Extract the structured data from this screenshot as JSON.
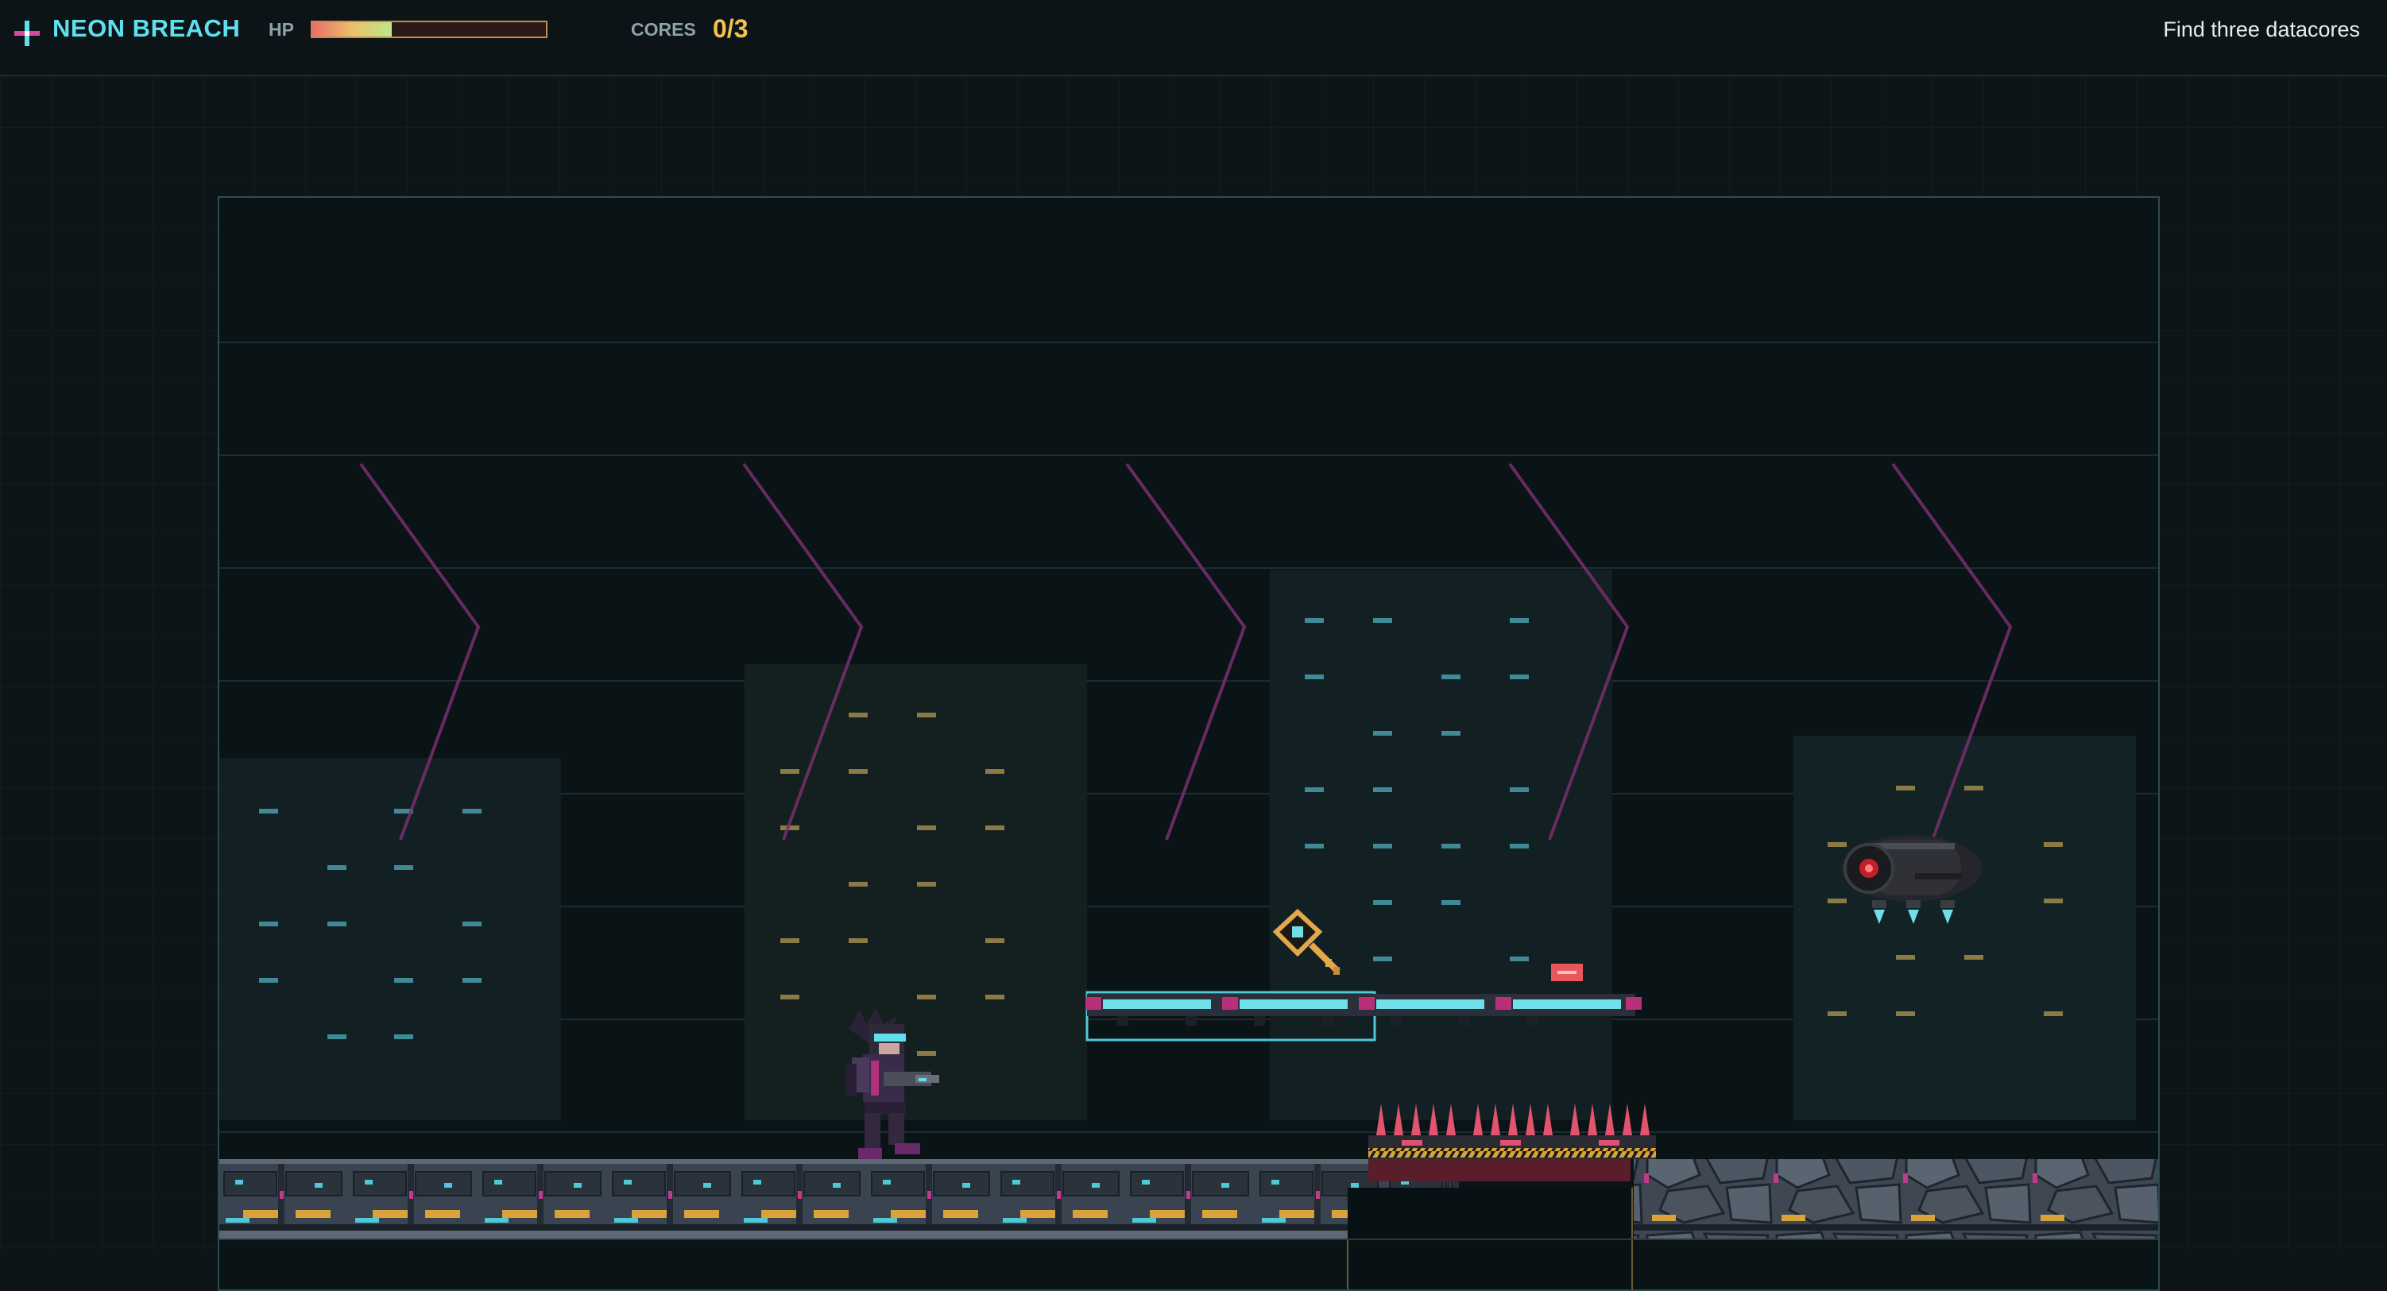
{
  "app": {
    "title": "NEON BREACH",
    "logo_icon": "crosshair-plus-icon"
  },
  "hud": {
    "hp_label": "HP",
    "hp_fraction": 0.34,
    "cores_label": "CORES",
    "cores_value": "0/3",
    "cores_collected": 0,
    "cores_total": 3,
    "objective": "Find three datacores"
  },
  "colors": {
    "accent_cyan": "#5ee0ee",
    "accent_gold": "#f2c24c",
    "neon_magenta": "#b0307a",
    "hp_gradient": [
      "#e86d6b",
      "#ecc06a",
      "#b9e88c"
    ]
  },
  "scene": {
    "player_icon": "cyber-gunner-player-sprite",
    "enemy_icon": "hover-drone-enemy-sprite",
    "pickup_icon": "gold-keycard-key-icon",
    "hazard_icon": "red-spike-trap",
    "platform_icon": "neon-floating-platform"
  }
}
